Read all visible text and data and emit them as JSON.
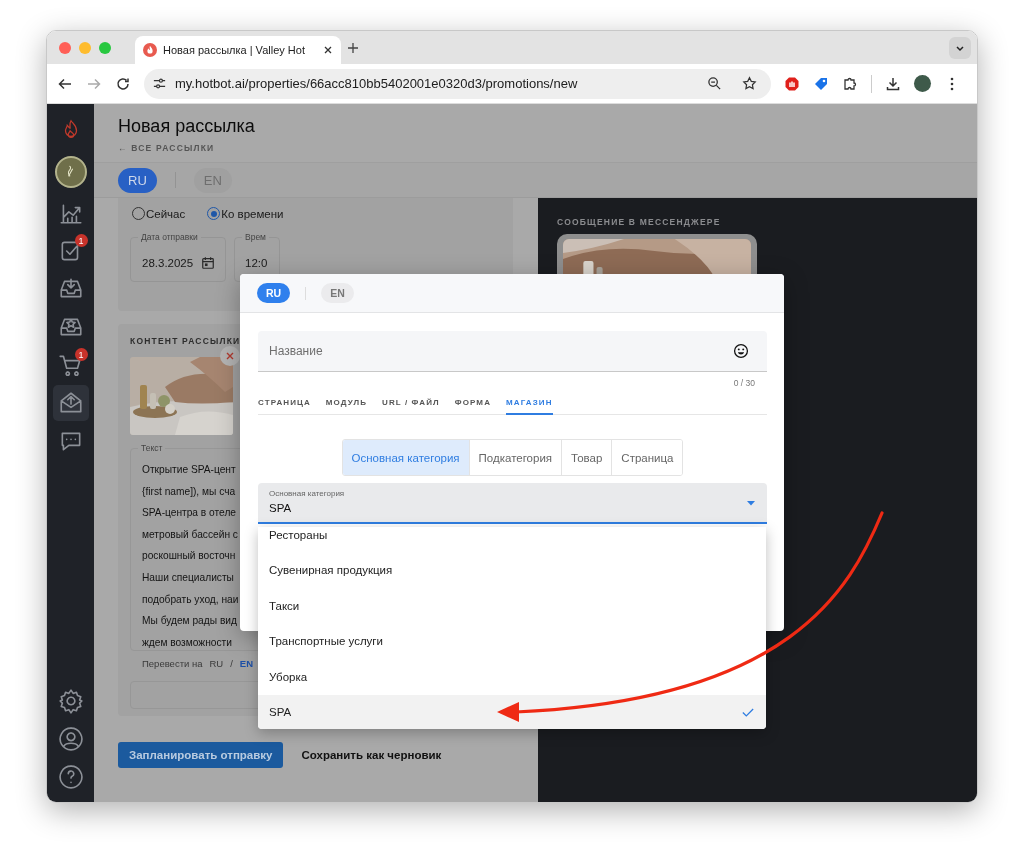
{
  "browser": {
    "tab_title": "Новая рассылка | Valley Hot",
    "url": "my.hotbot.ai/properties/66acc810bb5402001e0320d3/promotions/new"
  },
  "sidebar": {
    "top_items": [
      {
        "kind": "chart",
        "selected": false
      },
      {
        "kind": "tasks",
        "selected": false,
        "badge": "1"
      },
      {
        "kind": "inbox-download",
        "selected": false
      },
      {
        "kind": "inbox-star",
        "selected": false
      },
      {
        "kind": "cart",
        "selected": false,
        "badge": "1"
      },
      {
        "kind": "mail-upload",
        "selected": true
      },
      {
        "kind": "chat",
        "selected": false
      }
    ],
    "bottom_items": [
      {
        "kind": "gear",
        "selected": false
      },
      {
        "kind": "user",
        "selected": false
      },
      {
        "kind": "help",
        "selected": false
      }
    ]
  },
  "page": {
    "title": "Новая рассылка",
    "back_link": "← ВСЕ РАССЫЛКИ",
    "languages": [
      {
        "label": "RU",
        "selected": true
      },
      {
        "label": "EN",
        "selected": false
      }
    ]
  },
  "schedule": {
    "options": [
      {
        "label": "Сейчас",
        "selected": false
      },
      {
        "label": "Ко времени",
        "selected": true
      }
    ],
    "date_field": {
      "label": "Дата отправки",
      "value": "28.3.2025"
    },
    "time_field": {
      "label": "Врем",
      "value": "12:0"
    }
  },
  "content": {
    "heading": "КОНТЕНТ РАССЫЛКИ",
    "text_label": "Текст",
    "text_lines": [
      "Открытие SPA-цент",
      "{first name]), мы сча",
      "SPA-центра в отеле",
      "метровый бассейн с",
      "роскошный восточн",
      "Наши специалисты",
      "подобрать уход, наи",
      "Мы будем рады вид",
      "ждем возможности"
    ],
    "translate": {
      "label": "Перевести на",
      "separator": "/",
      "options": [
        {
          "label": "RU",
          "selected": false
        },
        {
          "label": "EN",
          "selected": true
        }
      ]
    }
  },
  "actions": {
    "primary": "Запланировать отправку",
    "secondary": "Сохранить как черновик"
  },
  "preview": {
    "heading": "СООБЩЕНИЕ В МЕССЕНДЖЕРЕ"
  },
  "modal": {
    "languages": [
      {
        "label": "RU",
        "selected": true
      },
      {
        "label": "EN",
        "selected": false
      }
    ],
    "name_field": {
      "placeholder": "Название",
      "counter": "0 / 30"
    },
    "tabs": [
      {
        "label": "СТРАНИЦА",
        "selected": false
      },
      {
        "label": "МОДУЛЬ",
        "selected": false
      },
      {
        "label": "URL / ФАЙЛ",
        "selected": false
      },
      {
        "label": "ФОРМА",
        "selected": false
      },
      {
        "label": "МАГАЗИН",
        "selected": true
      }
    ],
    "segments": [
      {
        "label": "Основная категория",
        "selected": true
      },
      {
        "label": "Подкатегория",
        "selected": false
      },
      {
        "label": "Товар",
        "selected": false
      },
      {
        "label": "Страница",
        "selected": false
      }
    ],
    "select": {
      "label": "Основная категория",
      "value": "SPA"
    },
    "options": [
      {
        "label": "Рестораны",
        "selected": false
      },
      {
        "label": "Сувенирная продукция",
        "selected": false
      },
      {
        "label": "Такси",
        "selected": false
      },
      {
        "label": "Транспортные услуги",
        "selected": false
      },
      {
        "label": "Уборка",
        "selected": false
      },
      {
        "label": "SPA",
        "selected": true
      }
    ]
  }
}
